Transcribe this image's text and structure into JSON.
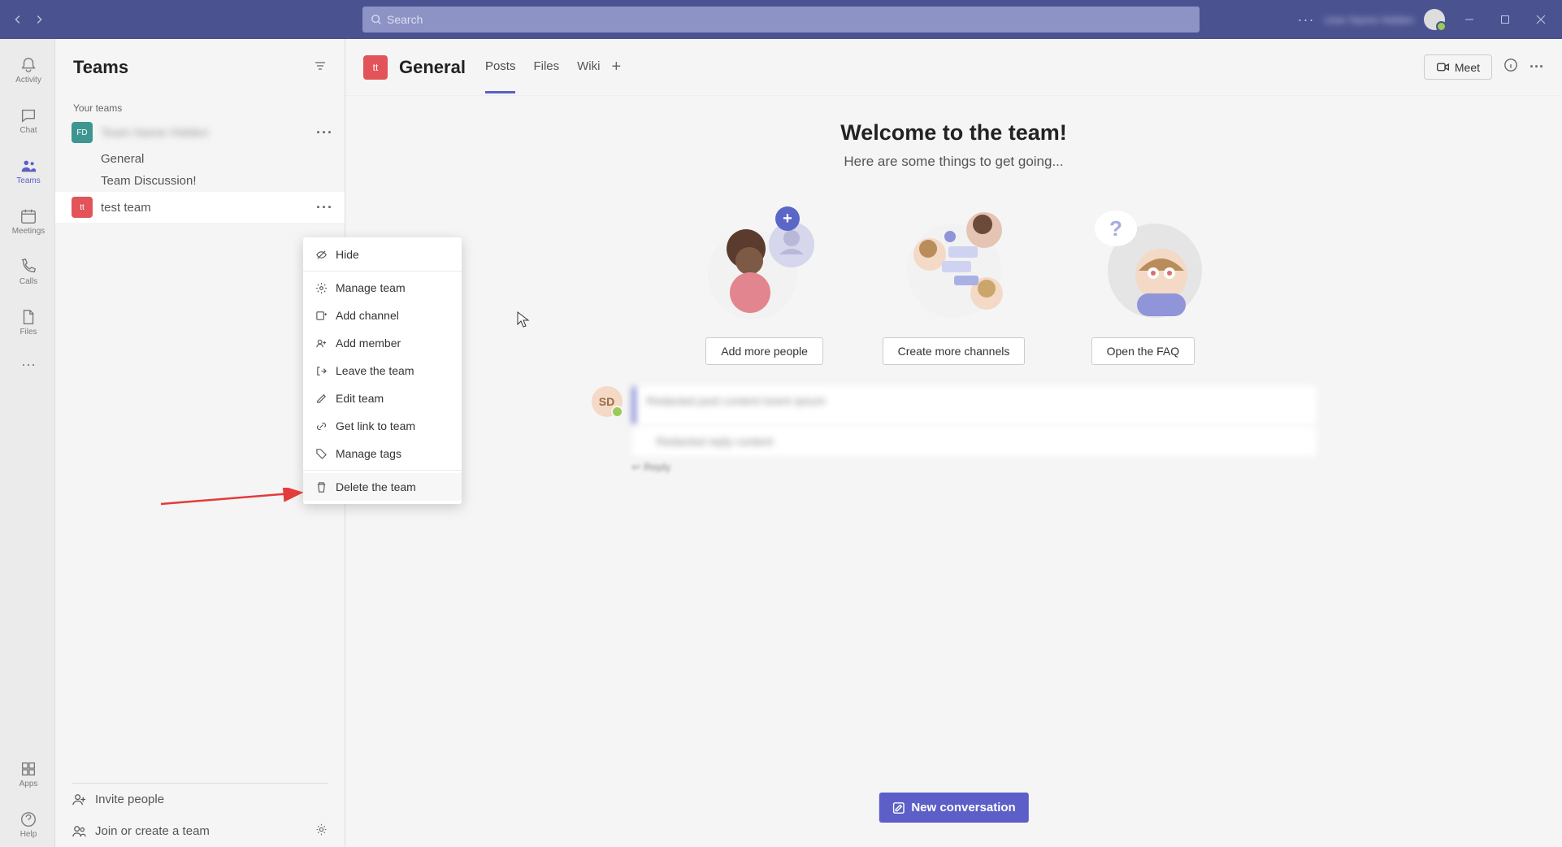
{
  "titlebar": {
    "search_placeholder": "Search",
    "user_name": "User Name Hidden"
  },
  "rail": {
    "activity": "Activity",
    "chat": "Chat",
    "teams": "Teams",
    "meetings": "Meetings",
    "calls": "Calls",
    "files": "Files",
    "apps": "Apps",
    "help": "Help"
  },
  "sidebar": {
    "title": "Teams",
    "your_teams_label": "Your teams",
    "team1_name": "Team Name Hidden",
    "team1_initials": "FD",
    "channels1": [
      "General",
      "Team Discussion!"
    ],
    "team2_name": "test team",
    "team2_initials": "tt",
    "invite_people": "Invite people",
    "join_create": "Join or create a team"
  },
  "context_menu": {
    "hide": "Hide",
    "manage_team": "Manage team",
    "add_channel": "Add channel",
    "add_member": "Add member",
    "leave_team": "Leave the team",
    "edit_team": "Edit team",
    "get_link": "Get link to team",
    "manage_tags": "Manage tags",
    "delete_team": "Delete the team"
  },
  "header": {
    "channel_initials": "tt",
    "channel_name": "General",
    "tabs": [
      "Posts",
      "Files",
      "Wiki"
    ],
    "meet_label": "Meet"
  },
  "welcome": {
    "title": "Welcome to the team!",
    "subtitle": "Here are some things to get going...",
    "btn1": "Add more people",
    "btn2": "Create more channels",
    "btn3": "Open the FAQ"
  },
  "post": {
    "avatar_initials": "SD"
  },
  "composer": {
    "new_conversation": "New conversation"
  }
}
